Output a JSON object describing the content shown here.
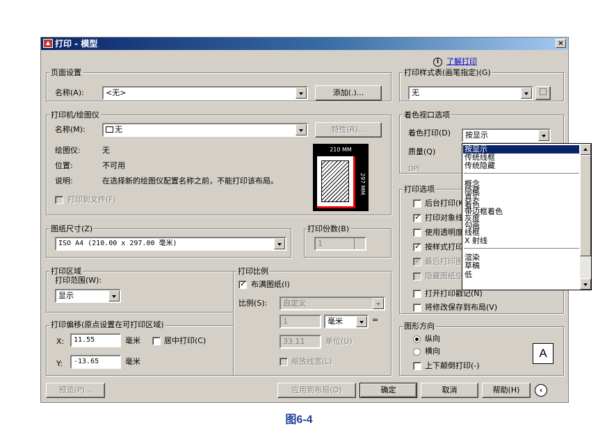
{
  "window": {
    "title": "打印 - 模型",
    "close": "×"
  },
  "help": {
    "info_icon": "i",
    "link": "了解打印"
  },
  "page_setup": {
    "group": "页面设置",
    "name_label": "名称(A):",
    "name_value": "<无>",
    "add_button": "添加(.)..."
  },
  "printer": {
    "group": "打印机/绘图仪",
    "name_label": "名称(M):",
    "name_value": "无",
    "properties_button": "特性(R)...",
    "plotter_label": "绘图仪:",
    "plotter_value": "无",
    "location_label": "位置:",
    "location_value": "不可用",
    "desc_label": "说明:",
    "desc_value": "在选择新的绘图仪配置名称之前，不能打印该布局。",
    "print_to_file": "打印到文件(F)",
    "preview_width": "210 MM",
    "preview_height": "297 MM"
  },
  "paper_size": {
    "group": "图纸尺寸(Z)",
    "value": "ISO A4 (210.00 x 297.00 毫米)"
  },
  "copies": {
    "group": "打印份数(B)",
    "value": "1"
  },
  "plot_area": {
    "group": "打印区域",
    "range_label": "打印范围(W):",
    "range_value": "显示"
  },
  "plot_offset": {
    "group": "打印偏移(原点设置在可打印区域)",
    "x_label": "X:",
    "x_value": "11.55",
    "x_unit": "毫米",
    "center": "居中打印(C)",
    "y_label": "Y:",
    "y_value": "-13.65",
    "y_unit": "毫米"
  },
  "plot_scale": {
    "group": "打印比例",
    "fit": "布满图纸(I)",
    "scale_label": "比例(S):",
    "scale_value": "自定义",
    "value1": "1",
    "unit_value": "毫米",
    "equals": "=",
    "value2": "33.11",
    "unit_label": "单位(U)",
    "lineweights": "缩放线宽(L)"
  },
  "style_table": {
    "group": "打印样式表(画笔指定)(G)",
    "value": "无"
  },
  "shaded": {
    "group": "着色视口选项",
    "shade_label": "着色打印(D)",
    "shade_value": "按显示",
    "quality_label": "质量(Q)",
    "dpi_label": "DPI"
  },
  "dropdown_list": {
    "items": [
      "按显示",
      "传统线框",
      "传统隐藏",
      "概念",
      "隐藏",
      "真实",
      "着色",
      "带边框着色",
      "灰度",
      "勾画",
      "线框",
      "X 射线",
      "渲染",
      "草稿",
      "低"
    ]
  },
  "plot_options": {
    "group": "打印选项",
    "items": [
      "后台打印(K)",
      "打印对象线",
      "使用透明度",
      "按样式打印",
      "最后打印图",
      "隐藏图纸空",
      "打开打印戳记(N)",
      "将修改保存到布局(V)"
    ]
  },
  "orientation": {
    "group": "图形方向",
    "portrait": "纵向",
    "landscape": "横向",
    "upside_down": "上下颠倒打印(-)",
    "icon_letter": "A"
  },
  "footer": {
    "preview": "预览(P)...",
    "apply": "应用到布局(O)",
    "ok": "确定",
    "cancel": "取消",
    "help": "帮助(H)"
  },
  "caption": "图6-4"
}
